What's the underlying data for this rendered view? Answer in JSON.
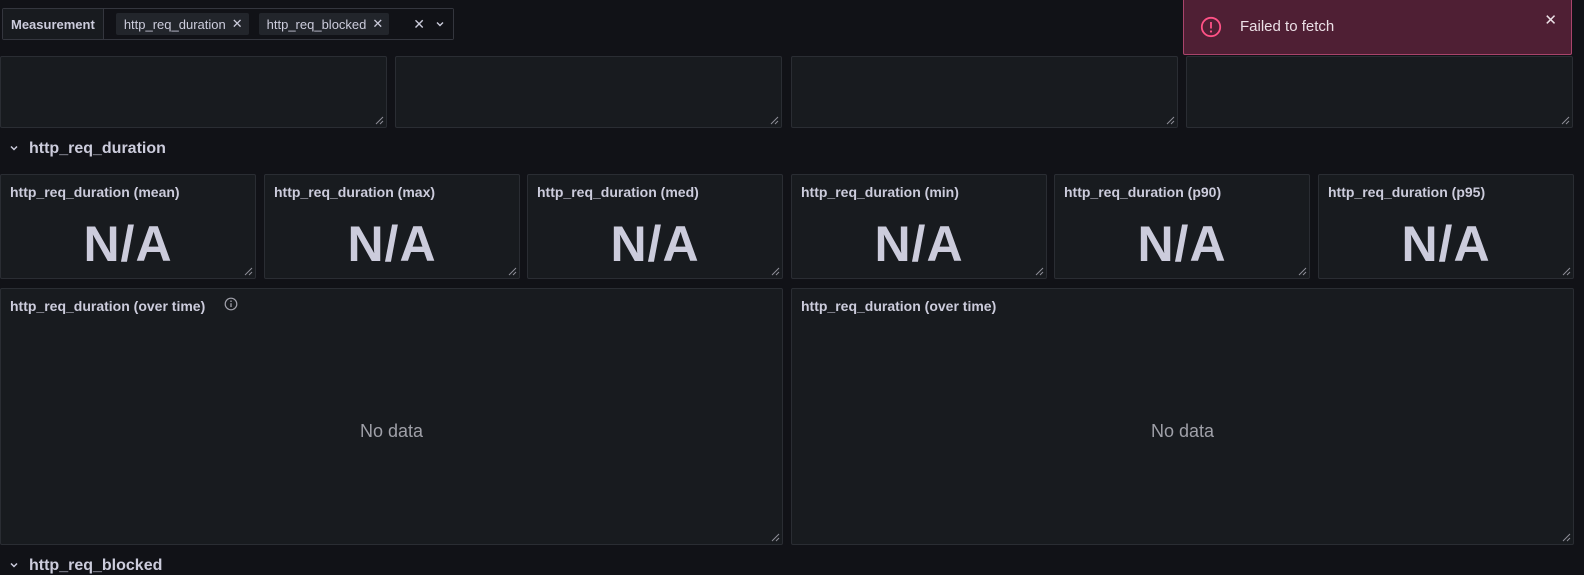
{
  "variables": {
    "label": "Measurement",
    "selected": [
      {
        "text": "http_req_duration",
        "remove_icon": "close-icon"
      },
      {
        "text": "http_req_blocked",
        "remove_icon": "close-icon"
      }
    ],
    "clear_symbol": "✕",
    "dropdown_symbol": "⌄"
  },
  "rows": {
    "duration_title": "http_req_duration",
    "blocked_title": "http_req_blocked"
  },
  "stats": [
    {
      "title": "http_req_duration (mean)",
      "value": "N/A"
    },
    {
      "title": "http_req_duration (max)",
      "value": "N/A"
    },
    {
      "title": "http_req_duration (med)",
      "value": "N/A"
    },
    {
      "title": "http_req_duration (min)",
      "value": "N/A"
    },
    {
      "title": "http_req_duration (p90)",
      "value": "N/A"
    },
    {
      "title": "http_req_duration (p95)",
      "value": "N/A"
    }
  ],
  "timeseries": [
    {
      "title": "http_req_duration (over time)",
      "message": "No data",
      "has_info_icon": true
    },
    {
      "title": "http_req_duration (over time)",
      "message": "No data",
      "has_info_icon": false
    }
  ],
  "toast": {
    "message": "Failed to fetch",
    "close_symbol": "✕",
    "colors": {
      "background": "#4f1f34",
      "border": "#a9446b",
      "icon": "#ff5286"
    }
  }
}
